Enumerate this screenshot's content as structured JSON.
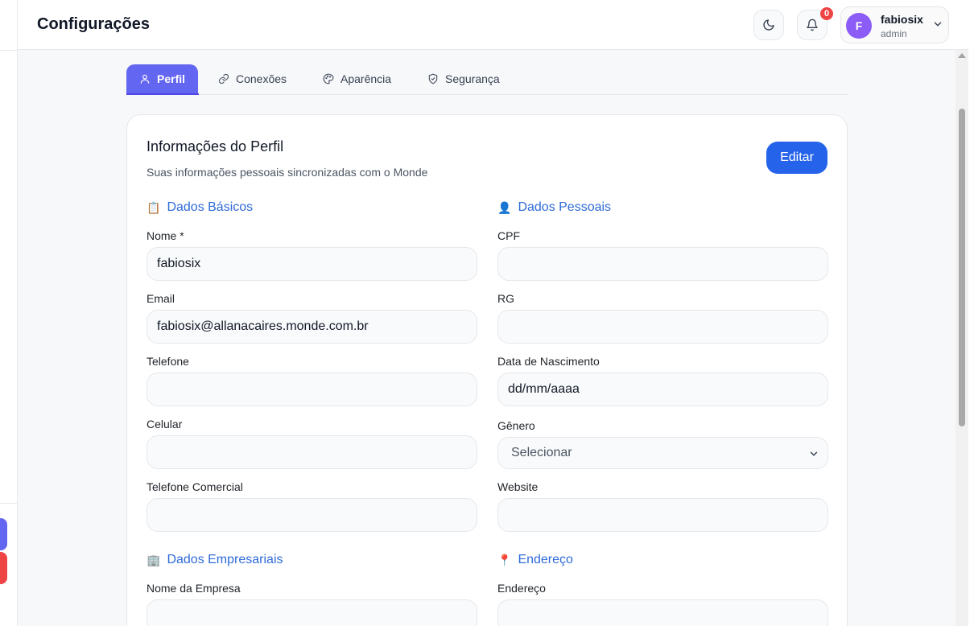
{
  "header": {
    "title": "Configurações",
    "notifications_count": "0",
    "user": {
      "initial": "F",
      "name": "fabiosix",
      "role": "admin"
    }
  },
  "tabs": [
    {
      "label": "Perfil",
      "icon": "user-icon",
      "active": true
    },
    {
      "label": "Conexões",
      "icon": "link-icon",
      "active": false
    },
    {
      "label": "Aparência",
      "icon": "palette-icon",
      "active": false
    },
    {
      "label": "Segurança",
      "icon": "shield-icon",
      "active": false
    }
  ],
  "card": {
    "title": "Informações do Perfil",
    "subtitle": "Suas informações pessoais sincronizadas com o Monde",
    "edit_label": "Editar"
  },
  "sections": {
    "basic": {
      "emoji": "📋",
      "title": "Dados Básicos"
    },
    "personal": {
      "emoji": "👤",
      "title": "Dados Pessoais"
    },
    "business": {
      "emoji": "🏢",
      "title": "Dados Empresariais"
    },
    "address": {
      "emoji": "📍",
      "title": "Endereço"
    }
  },
  "fields": {
    "nome": {
      "label": "Nome *",
      "value": "fabiosix"
    },
    "email": {
      "label": "Email",
      "value": "fabiosix@allanacaires.monde.com.br"
    },
    "telefone": {
      "label": "Telefone",
      "value": ""
    },
    "celular": {
      "label": "Celular",
      "value": ""
    },
    "telefone_comercial": {
      "label": "Telefone Comercial",
      "value": ""
    },
    "cpf": {
      "label": "CPF",
      "value": ""
    },
    "rg": {
      "label": "RG",
      "value": ""
    },
    "nascimento": {
      "label": "Data de Nascimento",
      "value": "dd/mm/aaaa"
    },
    "genero": {
      "label": "Gênero",
      "value": "Selecionar"
    },
    "website": {
      "label": "Website",
      "value": ""
    },
    "empresa": {
      "label": "Nome da Empresa",
      "value": ""
    },
    "endereco": {
      "label": "Endereço",
      "value": ""
    }
  },
  "colors": {
    "accent": "#6366f1",
    "primary_button": "#2563eb",
    "section_title": "#2f6bd8",
    "badge": "#ef4444",
    "avatar": "#8b5cf6"
  }
}
